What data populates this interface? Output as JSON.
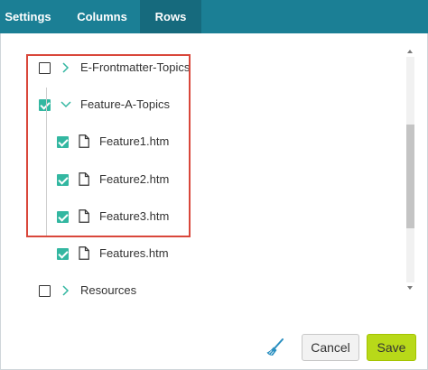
{
  "tabs": [
    {
      "label": "Settings",
      "active": false
    },
    {
      "label": "Columns",
      "active": false
    },
    {
      "label": "Rows",
      "active": true
    }
  ],
  "tree": {
    "items": [
      {
        "label": "E-Frontmatter-Topics",
        "type": "folder",
        "checked": false,
        "expanded": false
      },
      {
        "label": "Feature-A-Topics",
        "type": "folder",
        "checked": true,
        "expanded": true
      },
      {
        "label": "Feature1.htm",
        "type": "file",
        "checked": true
      },
      {
        "label": "Feature2.htm",
        "type": "file",
        "checked": true
      },
      {
        "label": "Feature3.htm",
        "type": "file",
        "checked": true
      },
      {
        "label": "Features.htm",
        "type": "file",
        "checked": true
      },
      {
        "label": "Resources",
        "type": "folder",
        "checked": false,
        "expanded": false
      }
    ]
  },
  "footer": {
    "clear_icon": "broom-icon",
    "cancel_label": "Cancel",
    "save_label": "Save"
  },
  "colors": {
    "tab_bar": "#1b7f95",
    "active_tab": "#166a7d",
    "checkbox_checked": "#33b7a1",
    "chevron": "#33b7a1",
    "highlight_border": "#d9473b",
    "save_button": "#b8d919",
    "broom_icon": "#2a8fc0"
  }
}
